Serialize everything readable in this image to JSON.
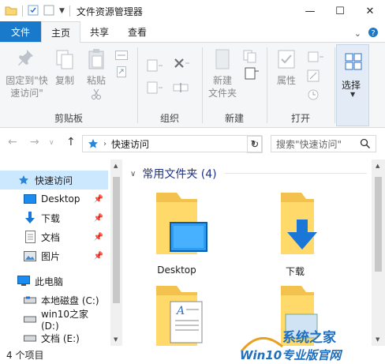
{
  "window": {
    "title": "文件资源管理器"
  },
  "ribbon_tabs": [
    "文件",
    "主页",
    "共享",
    "查看"
  ],
  "ribbon": {
    "pin_label_1": "固定到\"快",
    "pin_label_2": "速访问\"",
    "copy_label": "复制",
    "paste_label": "粘贴",
    "clipboard_group": "剪贴板",
    "organize_group": "组织",
    "new_folder_1": "新建",
    "new_folder_2": "文件夹",
    "new_group": "新建",
    "properties_label": "属性",
    "open_group": "打开",
    "select_label": "选择"
  },
  "address": {
    "location": "快速访问",
    "search_placeholder": "搜索\"快速访问\""
  },
  "nav": {
    "quick_access": "快速访问",
    "items": [
      "Desktop",
      "下载",
      "文档",
      "图片"
    ],
    "this_pc": "此电脑",
    "drives": [
      "本地磁盘 (C:)",
      "win10之家 (D:)",
      "文档 (E:)"
    ]
  },
  "content": {
    "group_header": "常用文件夹 (4)",
    "folders": [
      "Desktop",
      "下载"
    ]
  },
  "status": {
    "count": "4 个项目"
  },
  "watermark": {
    "text1": "系统之家",
    "text2": "Win10专业版官网"
  }
}
